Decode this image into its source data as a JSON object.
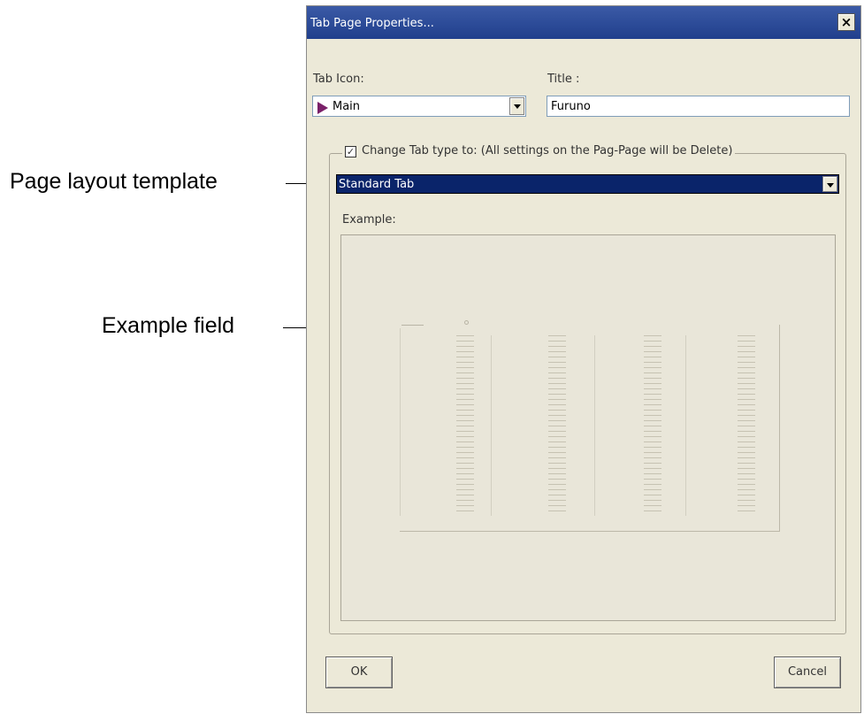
{
  "annotations": {
    "layout_template": "Page layout template",
    "example_field": "Example field"
  },
  "dialog": {
    "title": "Tab Page Properties...",
    "close_label": "×",
    "tab_icon_label": "Tab Icon:",
    "tab_icon_value": "Main",
    "tab_icon_color": "#7a2069",
    "title_label": "Title :",
    "title_value": "Furuno",
    "change_type_label": "Change Tab type to: (All settings on the Pag-Page will be Delete)",
    "change_type_checked": true,
    "checkbox_mark": "✓",
    "tab_type_value": "Standard Tab",
    "example_label": "Example:",
    "ok_label": "OK",
    "cancel_label": "Cancel"
  }
}
